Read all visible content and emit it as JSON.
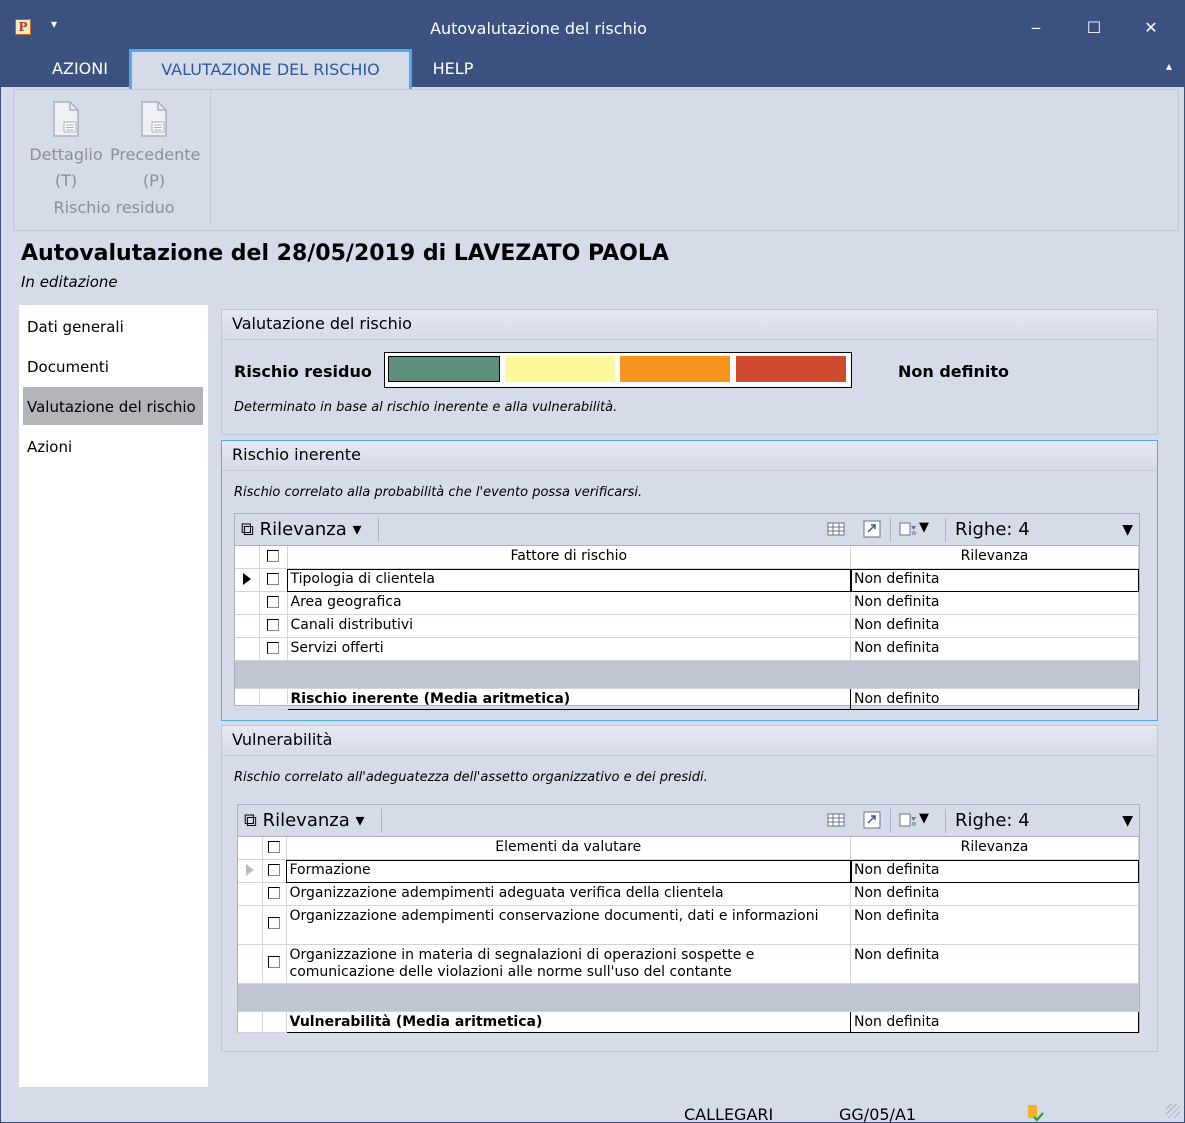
{
  "window": {
    "app_icon": "P",
    "title": "Autovalutazione del rischio",
    "controls": {
      "minimize": "‒",
      "maximize": "☐",
      "close": "✕"
    }
  },
  "tabs": [
    {
      "label": "AZIONI"
    },
    {
      "label": "VALUTAZIONE DEL RISCHIO",
      "active": true
    },
    {
      "label": "HELP"
    }
  ],
  "ribbon": {
    "buttons": [
      {
        "line1": "Dettaglio",
        "line2": "(T)",
        "icon": "document-icon"
      },
      {
        "line1": "Precedente",
        "line2": "(P)",
        "icon": "document-icon"
      }
    ],
    "group_label": "Rischio residuo"
  },
  "page": {
    "title": "Autovalutazione del 28/05/2019 di LAVEZATO PAOLA",
    "subtitle": "In editazione"
  },
  "nav": [
    {
      "label": "Dati generali"
    },
    {
      "label": "Documenti"
    },
    {
      "label": "Valutazione del rischio",
      "active": true
    },
    {
      "label": "Azioni"
    }
  ],
  "valutazione": {
    "header": "Valutazione del rischio",
    "risk_label": "Rischio residuo",
    "risk_colors": [
      "#5c8f79",
      "#fbf99c",
      "#f7941d",
      "#cf4a2f"
    ],
    "risk_status": "Non definito",
    "description": "Determinato in base al rischio inerente e alla vulnerabilità."
  },
  "inerente": {
    "header": "Rischio inerente",
    "description": "Rischio correlato alla probabilità che l'evento possa verificarsi.",
    "toolbar": {
      "filter_label": "Rilevanza ▾",
      "rows_label": "Righe: 4"
    },
    "columns": {
      "factor": "Fattore di rischio",
      "relevance": "Rilevanza"
    },
    "rows": [
      {
        "factor": "Tipologia di clientela",
        "relevance": "Non definita"
      },
      {
        "factor": "Area geografica",
        "relevance": "Non definita"
      },
      {
        "factor": "Canali distributivi",
        "relevance": "Non definita"
      },
      {
        "factor": "Servizi offerti",
        "relevance": "Non definita"
      }
    ],
    "total": {
      "label": "Rischio inerente (Media aritmetica)",
      "value": "Non definito"
    }
  },
  "vulnerabilita": {
    "header": "Vulnerabilità",
    "description": "Rischio correlato all'adeguatezza dell'assetto organizzativo e dei presidi.",
    "toolbar": {
      "filter_label": "Rilevanza ▾",
      "rows_label": "Righe: 4"
    },
    "columns": {
      "element": "Elementi da valutare",
      "relevance": "Rilevanza"
    },
    "rows": [
      {
        "element": "Formazione",
        "relevance": "Non definita"
      },
      {
        "element": "Organizzazione adempimenti adeguata verifica della clientela",
        "relevance": "Non definita"
      },
      {
        "element": "Organizzazione adempimenti conservazione documenti, dati e informazioni",
        "relevance": "Non definita"
      },
      {
        "element": "Organizzazione in materia di segnalazioni di operazioni sospette e comunicazione delle violazioni alle norme sull'uso del contante",
        "relevance": "Non definita"
      }
    ],
    "total": {
      "label": "Vulnerabilità (Media aritmetica)",
      "value": "Non definita"
    }
  },
  "statusbar": {
    "user": "CALLEGARI",
    "code": "GG/05/A1",
    "icon": "user-check-icon"
  }
}
